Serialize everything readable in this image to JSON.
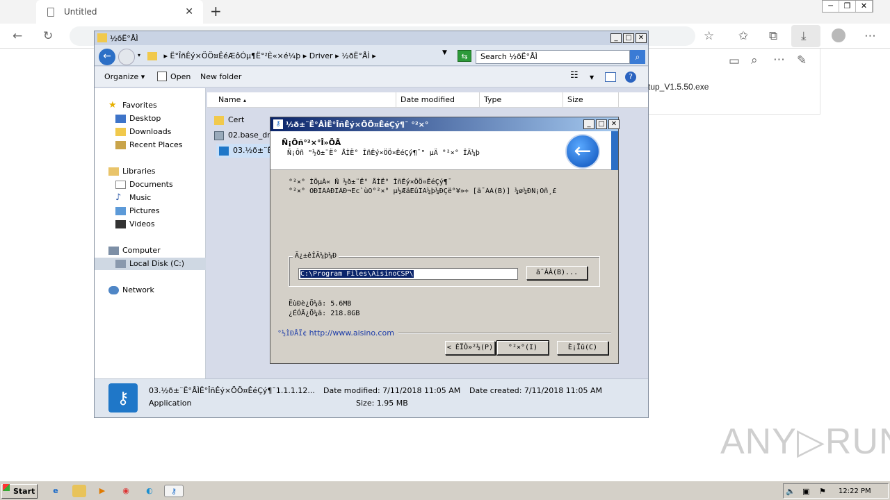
{
  "browser": {
    "tab_title": "Untitled",
    "download_file": "tup_V1.5.50.exe"
  },
  "explorer": {
    "title": "½ðË°ÅÌ",
    "breadcrumb": [
      "Ë°ÎñÊý×ÖÖ¤ÊéÆôÓµ¶Ë°²È«×é¼þ",
      "Driver",
      "½ðË°ÅÌ"
    ],
    "search_placeholder": "Search ½ðË°ÅÌ",
    "toolbar": {
      "organize": "Organize",
      "open": "Open",
      "new_folder": "New folder"
    },
    "nav": {
      "favorites": "Favorites",
      "desktop": "Desktop",
      "downloads": "Downloads",
      "recent": "Recent Places",
      "libraries": "Libraries",
      "documents": "Documents",
      "music": "Music",
      "pictures": "Pictures",
      "videos": "Videos",
      "computer": "Computer",
      "local_disk": "Local Disk (C:)",
      "network": "Network"
    },
    "columns": [
      "Name",
      "Date modified",
      "Type",
      "Size"
    ],
    "files": [
      "Cert",
      "02.base_dr",
      "03.½ð±¨Ë°"
    ],
    "details": {
      "name": "03.½ð±¨Ë°ÅÌË°ÎñÊý×ÖÖ¤ÊéÇý¶¯1.1.1.12...",
      "type": "Application",
      "modified": "Date modified:  7/11/2018 11:05 AM",
      "size": "Size:  1.95 MB",
      "created": "Date created:  7/11/2018 11:05 AM"
    }
  },
  "installer": {
    "title": "½ð±¨Ë°ÅÌË°ÎñÊý×ÖÖ¤ÊéÇý¶¯ °²×°",
    "banner_title": "Ñ¡Ôñ°²×°Î»ÖÃ",
    "banner_sub": "Ñ¡Ôñ \"½ð±¨Ë° ÅÌË° ÎñÊý×ÖÖ¤ÊéÇý¶¯\" µÄ °²×° ÎÄ¼þ",
    "desc1": "°²×° ÌÖµÀ« Ñ ½ð±¨Ë° ÅÌË° ÎñÊý×ÖÖ¤ÊéÇý¶¯",
    "desc2": "°²×° ÖÐÌÁÀÐÏÂÐ¬Ec`ùÖ°²×° µ½ÆäËûÎÄ¼þ¼ÐÇë°¥»÷ [ä¯ÀÀ(B)] ¼ø¼ÐÑ¡Ôñ¸£",
    "group_label": "Ä¿±êÎÄ¼þ¼Ð",
    "path": "C:\\Program Files\\AisinoCSP\\",
    "browse": "ä¯ÀÀ(B)...",
    "space_required": "ËùÐè¿Õ¼ä: 5.6MB",
    "space_available": "¿ÉÓÃ¿Õ¼ä: 218.8GB",
    "brand": "°½ÌÐÅÏ¢",
    "url": "http://www.aisino.com",
    "btn_back": "< ÉÏÒ»²½(P)",
    "btn_install": "°²×°(I)",
    "btn_cancel": "È¡Ïû(C)"
  },
  "taskbar": {
    "start": "Start",
    "clock": "12:22 PM"
  },
  "watermark": "ANY▷RUN",
  "colors": {
    "title_gradient_start": "#0a246a",
    "title_gradient_end": "#a6caf0",
    "link": "#1a3aa8",
    "dialog_bg": "#d4d0c8"
  }
}
